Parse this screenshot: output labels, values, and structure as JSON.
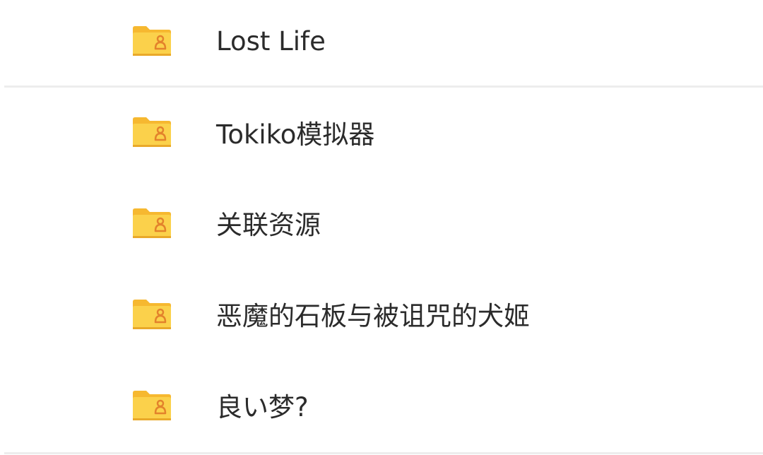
{
  "folders": [
    {
      "label": "Lost Life",
      "icon": "shared-folder-icon"
    },
    {
      "label": "Tokiko模拟器",
      "icon": "shared-folder-icon"
    },
    {
      "label": "关联资源",
      "icon": "shared-folder-icon"
    },
    {
      "label": "恶魔的石板与被诅咒的犬姬",
      "icon": "shared-folder-icon"
    },
    {
      "label": "良い梦?",
      "icon": "shared-folder-icon"
    }
  ],
  "colors": {
    "folder_body": "#fbd14b",
    "folder_tab": "#f6b830",
    "folder_badge": "#e3822b",
    "text": "#2b2b2b",
    "divider": "#ededed"
  }
}
